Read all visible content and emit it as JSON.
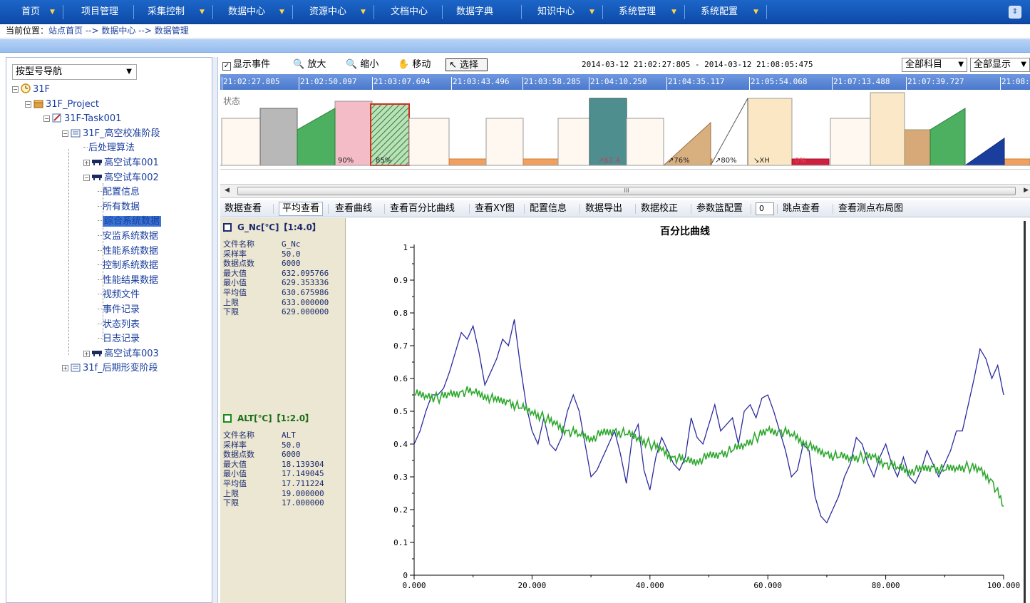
{
  "nav": {
    "items": [
      {
        "label": "首页",
        "x": 28,
        "arrow": true
      },
      {
        "label": "项目管理",
        "x": 112,
        "arrow": false
      },
      {
        "label": "采集控制",
        "x": 205,
        "arrow": true
      },
      {
        "label": "数据中心",
        "x": 318,
        "arrow": true
      },
      {
        "label": "资源中心",
        "x": 432,
        "arrow": true
      },
      {
        "label": "文档中心",
        "x": 546,
        "arrow": false
      },
      {
        "label": "数据字典",
        "x": 638,
        "arrow": false
      },
      {
        "label": "知识中心",
        "x": 752,
        "arrow": true
      },
      {
        "label": "系统管理",
        "x": 866,
        "arrow": true
      },
      {
        "label": "系统配置",
        "x": 981,
        "arrow": true
      }
    ]
  },
  "breadcrumb": {
    "label": "当前位置：",
    "path": "站点首页 --> 数据中心 --> 数据管理"
  },
  "tree": {
    "selector": "按型号导航",
    "nodes": [
      {
        "label": "31F",
        "depth": 0
      },
      {
        "label": "31F_Project",
        "depth": 1
      },
      {
        "label": "31F-Task001",
        "depth": 2
      },
      {
        "label": "31F_高空校准阶段",
        "depth": 3
      },
      {
        "label": "后处理算法",
        "depth": 4
      },
      {
        "label": "高空试车001",
        "depth": 4
      },
      {
        "label": "高空试车002",
        "depth": 4
      },
      {
        "label": "配置信息",
        "depth": 5
      },
      {
        "label": "所有数据",
        "depth": 5
      },
      {
        "label": "综合系统数据",
        "depth": 5,
        "selected": true
      },
      {
        "label": "安监系统数据",
        "depth": 5
      },
      {
        "label": "性能系统数据",
        "depth": 5
      },
      {
        "label": "控制系统数据",
        "depth": 5
      },
      {
        "label": "性能结果数据",
        "depth": 5
      },
      {
        "label": "视频文件",
        "depth": 5
      },
      {
        "label": "事件记录",
        "depth": 5
      },
      {
        "label": "状态列表",
        "depth": 5
      },
      {
        "label": "日志记录",
        "depth": 5
      },
      {
        "label": "高空试车003",
        "depth": 4
      },
      {
        "label": "31f_后期形变阶段",
        "depth": 3
      }
    ]
  },
  "toolbar": {
    "show_events": "显示事件",
    "zoom_in": "放大",
    "zoom_out": "缩小",
    "move": "移动",
    "select": "选择",
    "time_range": "2014-03-12 21:02:27:805 - 2014-03-12 21:08:05:475",
    "subject_select": "全部科目",
    "display_select": "全部显示"
  },
  "timeline": {
    "ticks": [
      "21:02:27.805",
      "21:02:50.097",
      "21:03:07.694",
      "21:03:43.496",
      "21:03:58.285",
      "21:04:10.250",
      "21:04:35.117",
      "21:05:54.068",
      "21:07:13.488",
      "21:07:39.727",
      "21:08:"
    ]
  },
  "events": {
    "status_label": "状态",
    "labels": [
      "90%",
      "85%",
      "↗62.4",
      "↗76%",
      "↗80%",
      "↘XH",
      "0%"
    ]
  },
  "scroll": {
    "thumb_grip": "III"
  },
  "actions": {
    "items": [
      "数据查看",
      "平均查看",
      "查看曲线",
      "查看百分比曲线",
      "查看XY图",
      "配置信息",
      "数据导出",
      "数据校正",
      "参数篮配置",
      "跳点查看",
      "查看测点布局图"
    ],
    "jump_value": "0"
  },
  "channels": [
    {
      "title": "G_Nc[℃]【1:4.0】",
      "color": "#1a2a8e",
      "file_label": "文件名称",
      "file": "G_Nc",
      "rate_label": "采样率",
      "rate": "50.0",
      "points_label": "数据点数",
      "points": "6000",
      "max_label": "最大值",
      "max": "632.095766",
      "min_label": "最小值",
      "min": "629.353336",
      "avg_label": "平均值",
      "avg": "630.675986",
      "upper_label": "上限",
      "upper": "633.000000",
      "lower_label": "下限",
      "lower": "629.000000"
    },
    {
      "title": "ALT[℃]【1:2.0】",
      "color": "#1a8a1a",
      "file_label": "文件名称",
      "file": "ALT",
      "rate_label": "采样率",
      "rate": "50.0",
      "points_label": "数据点数",
      "points": "6000",
      "max_label": "最大值",
      "max": "18.139304",
      "min_label": "最小值",
      "min": "17.149045",
      "avg_label": "平均值",
      "avg": "17.711224",
      "upper_label": "上限",
      "upper": "19.000000",
      "lower_label": "下限",
      "lower": "17.000000"
    }
  ],
  "chart_data": {
    "type": "line",
    "title": "百分比曲线",
    "xlabel": "",
    "ylabel": "",
    "xlim": [
      0,
      100
    ],
    "ylim": [
      0,
      1
    ],
    "x_ticks": [
      "0.000",
      "20.000",
      "40.000",
      "60.000",
      "80.000",
      "100.000"
    ],
    "y_ticks": [
      "0",
      "0.1",
      "0.2",
      "0.3",
      "0.4",
      "0.5",
      "0.6",
      "0.7",
      "0.8",
      "0.9",
      "1"
    ],
    "series": [
      {
        "name": "G_Nc[℃]【1:4.0】",
        "color": "#2b2b9e",
        "x": [
          0,
          1,
          2,
          3,
          4,
          5,
          6,
          7,
          8,
          9,
          10,
          11,
          12,
          13,
          14,
          15,
          16,
          17,
          18,
          19,
          20,
          21,
          22,
          23,
          24,
          25,
          26,
          27,
          28,
          29,
          30,
          31,
          32,
          33,
          34,
          35,
          36,
          37,
          38,
          39,
          40,
          41,
          42,
          43,
          44,
          45,
          46,
          47,
          48,
          49,
          50,
          51,
          52,
          53,
          54,
          55,
          56,
          57,
          58,
          59,
          60,
          61,
          62,
          63,
          64,
          65,
          66,
          67,
          68,
          69,
          70,
          71,
          72,
          73,
          74,
          75,
          76,
          77,
          78,
          79,
          80,
          81,
          82,
          83,
          84,
          85,
          86,
          87,
          88,
          89,
          90,
          91,
          92,
          93,
          94,
          95,
          96,
          97,
          98,
          99,
          100
        ],
        "y": [
          0.4,
          0.44,
          0.5,
          0.55,
          0.55,
          0.57,
          0.62,
          0.68,
          0.74,
          0.72,
          0.76,
          0.68,
          0.58,
          0.62,
          0.66,
          0.72,
          0.7,
          0.78,
          0.64,
          0.52,
          0.44,
          0.4,
          0.48,
          0.4,
          0.38,
          0.42,
          0.5,
          0.55,
          0.5,
          0.4,
          0.3,
          0.32,
          0.36,
          0.4,
          0.44,
          0.37,
          0.28,
          0.42,
          0.46,
          0.32,
          0.26,
          0.36,
          0.42,
          0.38,
          0.34,
          0.32,
          0.36,
          0.48,
          0.42,
          0.4,
          0.46,
          0.52,
          0.44,
          0.46,
          0.48,
          0.4,
          0.5,
          0.52,
          0.48,
          0.54,
          0.55,
          0.5,
          0.44,
          0.38,
          0.3,
          0.32,
          0.4,
          0.38,
          0.24,
          0.18,
          0.16,
          0.2,
          0.24,
          0.3,
          0.34,
          0.42,
          0.4,
          0.34,
          0.3,
          0.36,
          0.4,
          0.34,
          0.3,
          0.36,
          0.3,
          0.28,
          0.32,
          0.38,
          0.34,
          0.3,
          0.34,
          0.38,
          0.44,
          0.44,
          0.52,
          0.6,
          0.69,
          0.66,
          0.6,
          0.64,
          0.55
        ]
      },
      {
        "name": "ALT[℃]【1:2.0】",
        "color": "#2ea82e",
        "x": [
          0,
          2,
          4,
          6,
          8,
          10,
          12,
          14,
          16,
          18,
          20,
          22,
          24,
          26,
          28,
          30,
          32,
          34,
          36,
          38,
          40,
          42,
          44,
          46,
          48,
          50,
          52,
          54,
          56,
          58,
          60,
          62,
          64,
          66,
          68,
          70,
          72,
          74,
          76,
          78,
          80,
          82,
          84,
          86,
          88,
          90,
          92,
          94,
          96,
          98,
          100
        ],
        "y": [
          0.55,
          0.55,
          0.54,
          0.55,
          0.56,
          0.56,
          0.55,
          0.53,
          0.53,
          0.51,
          0.5,
          0.48,
          0.46,
          0.44,
          0.43,
          0.42,
          0.43,
          0.44,
          0.43,
          0.42,
          0.4,
          0.38,
          0.36,
          0.35,
          0.35,
          0.36,
          0.37,
          0.38,
          0.4,
          0.42,
          0.44,
          0.44,
          0.43,
          0.41,
          0.38,
          0.37,
          0.36,
          0.36,
          0.36,
          0.36,
          0.34,
          0.33,
          0.32,
          0.32,
          0.33,
          0.32,
          0.33,
          0.33,
          0.32,
          0.29,
          0.21
        ]
      }
    ]
  }
}
